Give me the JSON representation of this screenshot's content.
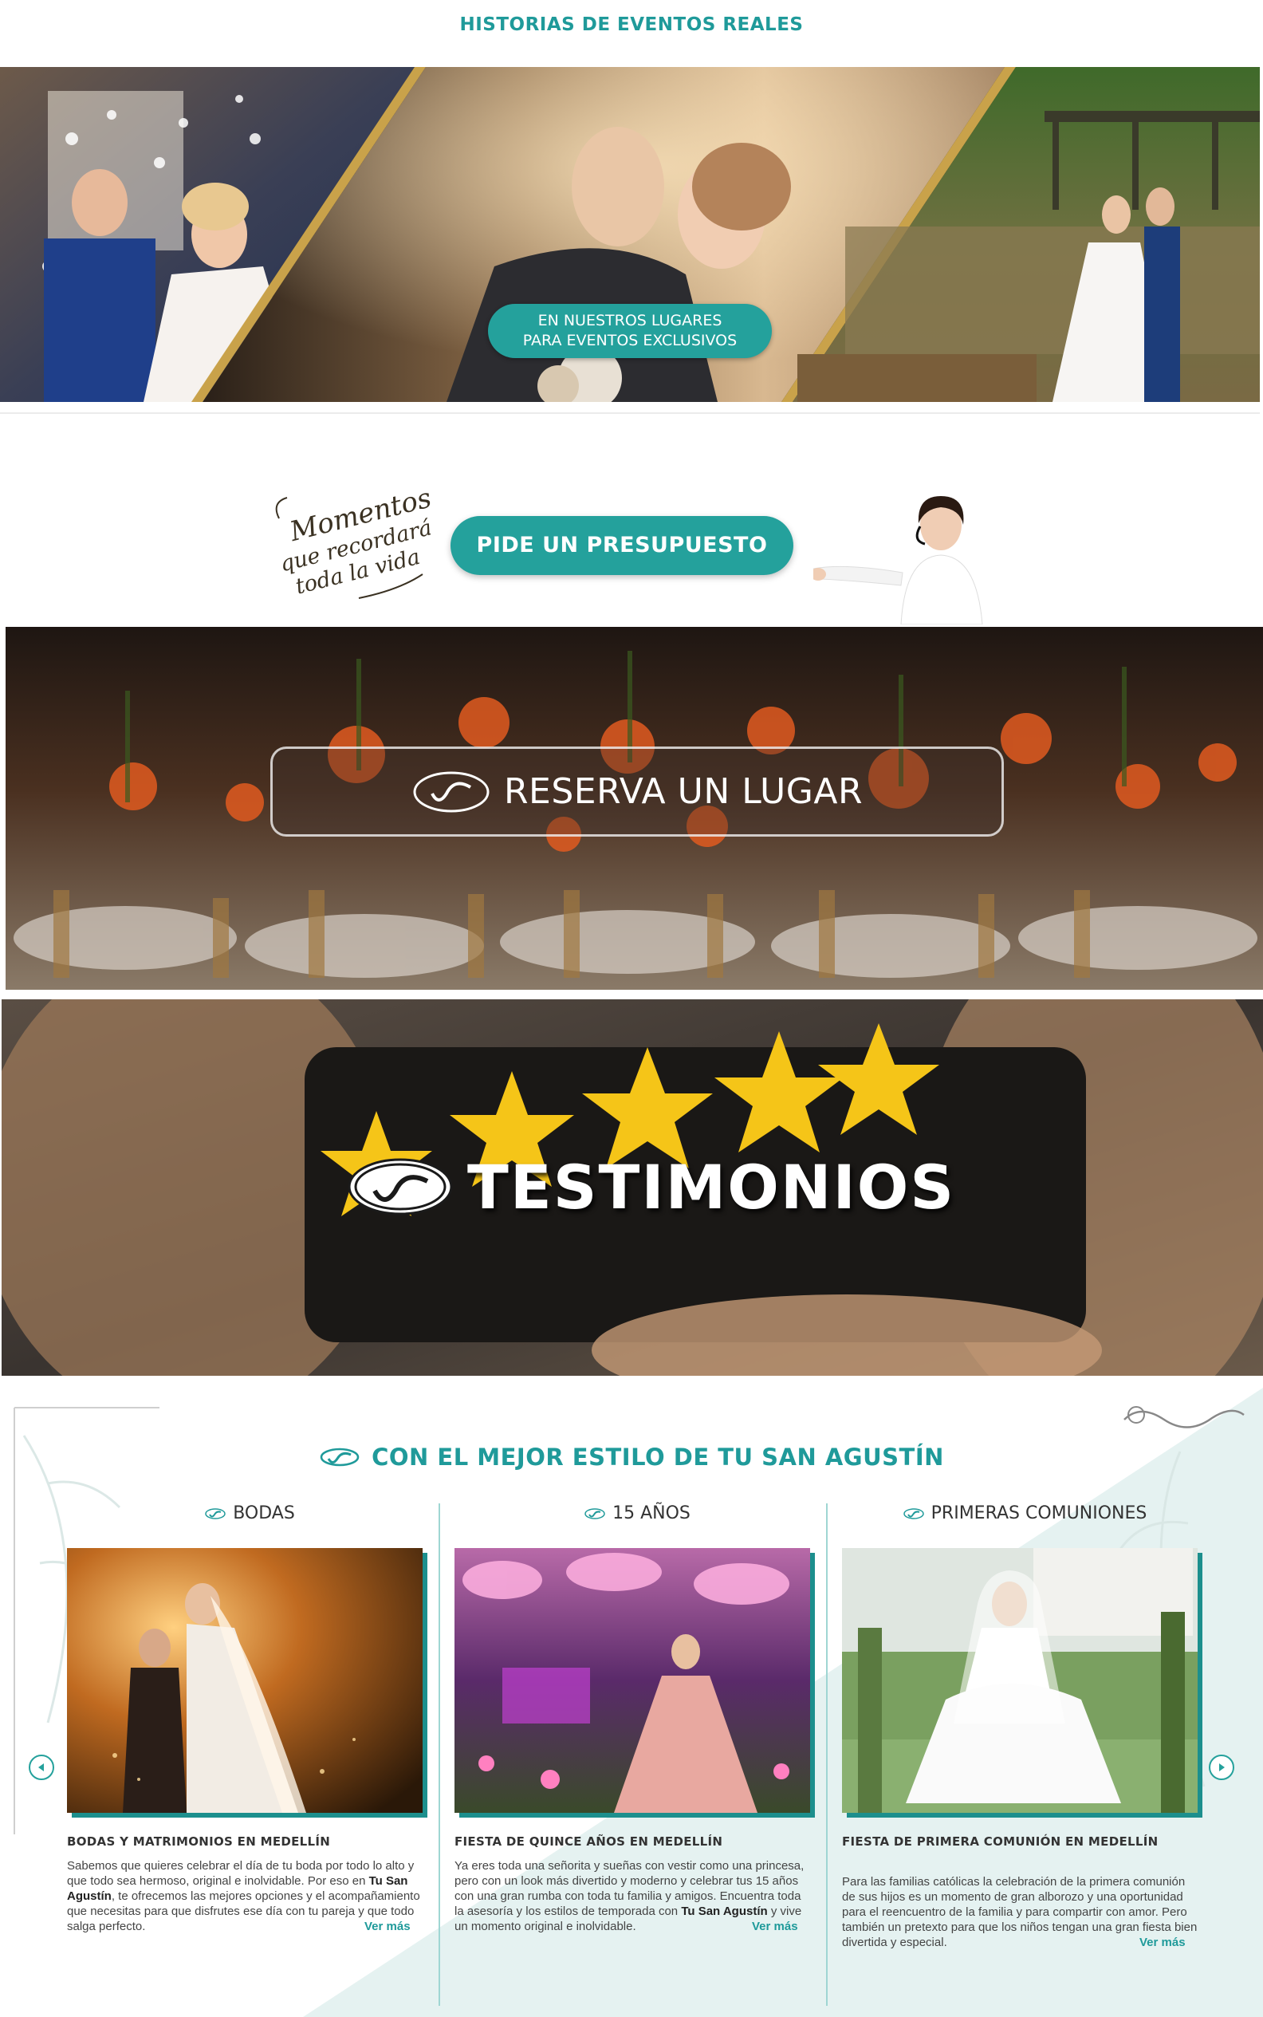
{
  "header": {
    "title": "HISTORIAS DE EVENTOS REALES"
  },
  "banner": {
    "line1": "EN NUESTROS LUGARES",
    "line2": "PARA EVENTOS EXCLUSIVOS"
  },
  "cta": {
    "script_lines": [
      "Momentos",
      "que recordarás",
      "toda la vida"
    ],
    "presupuesto_label": "PIDE UN PRESUPUESTO"
  },
  "reserva": {
    "label": "RESERVA UN LUGAR"
  },
  "testimonios": {
    "label": "TESTIMONIOS"
  },
  "estilo": {
    "heading": "CON EL MEJOR ESTILO DE TU SAN AGUSTÍN",
    "columns": [
      {
        "head": "BODAS",
        "title": "BODAS Y MATRIMONIOS EN MEDELLÍN",
        "text_before": "Sabemos que quieres celebrar el día de tu boda por todo lo alto y que todo sea hermoso, original e inolvidable. Por eso en ",
        "text_bold": "Tu San Agustín",
        "text_after": ", te ofrecemos las mejores opciones y el acompañamiento que necesitas para que disfrutes ese día con tu pareja y que todo salga perfecto.",
        "link": "Ver más"
      },
      {
        "head": "15 AÑOS",
        "title": "FIESTA DE QUINCE AÑOS EN MEDELLÍN",
        "text_before": "Ya eres toda una señorita y sueñas con vestir como una princesa, pero con un look más divertido y moderno y celebrar tus 15 años con una gran rumba con toda tu familia y amigos. Encuentra toda la asesoría y los estilos de temporada con ",
        "text_bold": "Tu San Agustín",
        "text_after": " y vive un momento original e inolvidable.",
        "link": "Ver más"
      },
      {
        "head": "PRIMERAS COMUNIONES",
        "title": "FIESTA DE PRIMERA COMUNIÓN EN MEDELLÍN",
        "text_before": "Para las familias católicas la celebración de la primera comunión de sus hijos es un momento de gran alborozo y una oportunidad para el reencuentro de la familia y para compartir con amor. Pero también un pretexto para que los niños tengan una gran fiesta bien divertida y especial.",
        "text_bold": "",
        "text_after": "",
        "link": "Ver más"
      }
    ]
  },
  "icons": {
    "carousel_prev": "chevron-left-icon",
    "carousel_next": "chevron-right-icon",
    "brand_mark": "san-agustin-logo-icon"
  },
  "colors": {
    "accent": "#24a19c",
    "accent_dark": "#1c8f8d",
    "heading_teal": "#1f9a9a"
  }
}
